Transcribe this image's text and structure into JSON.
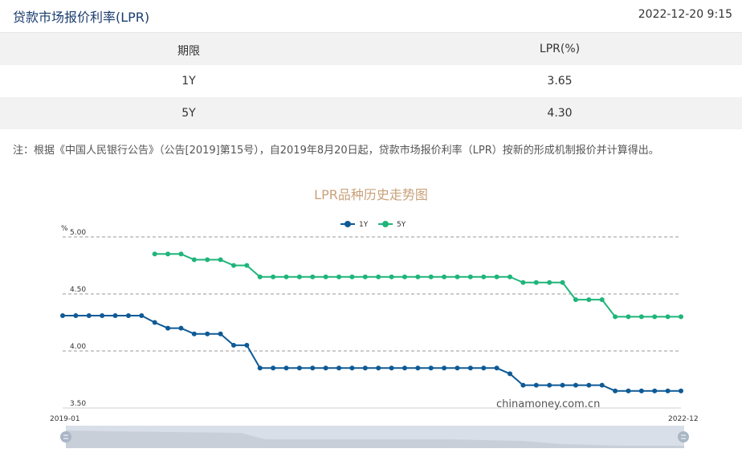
{
  "header": {
    "title": "贷款市场报价利率(LPR)",
    "timestamp": "2022-12-20 9:15"
  },
  "table": {
    "headers": [
      "期限",
      "LPR(%)"
    ],
    "rows": [
      {
        "term": "1Y",
        "rate": "3.65"
      },
      {
        "term": "5Y",
        "rate": "4.30"
      }
    ]
  },
  "note": "注：根据《中国人民银行公告》（公告[2019]第15号），自2019年8月20日起，贷款市场报价利率（LPR）按新的形成机制报价并计算得出。",
  "chart_data": {
    "type": "line",
    "title": "LPR品种历史走势图",
    "ylabel": "%",
    "ylim": [
      3.5,
      5.0
    ],
    "yticks": [
      "5.00",
      "4.50",
      "4.00",
      "3.50"
    ],
    "x_start_label": "2019-01",
    "x_end_label": "2022-12",
    "legend": "top-center",
    "grid": true,
    "watermark": "chinamoney.com.cn",
    "series": [
      {
        "name": "1Y",
        "color": "#0e5a96",
        "values": [
          4.31,
          4.31,
          4.31,
          4.31,
          4.31,
          4.31,
          4.31,
          4.25,
          4.2,
          4.2,
          4.15,
          4.15,
          4.15,
          4.05,
          4.05,
          3.85,
          3.85,
          3.85,
          3.85,
          3.85,
          3.85,
          3.85,
          3.85,
          3.85,
          3.85,
          3.85,
          3.85,
          3.85,
          3.85,
          3.85,
          3.85,
          3.85,
          3.85,
          3.85,
          3.8,
          3.7,
          3.7,
          3.7,
          3.7,
          3.7,
          3.7,
          3.7,
          3.65,
          3.65,
          3.65,
          3.65,
          3.65,
          3.65
        ]
      },
      {
        "name": "5Y",
        "color": "#1fb57a",
        "values": [
          null,
          null,
          null,
          null,
          null,
          null,
          null,
          4.85,
          4.85,
          4.85,
          4.8,
          4.8,
          4.8,
          4.75,
          4.75,
          4.65,
          4.65,
          4.65,
          4.65,
          4.65,
          4.65,
          4.65,
          4.65,
          4.65,
          4.65,
          4.65,
          4.65,
          4.65,
          4.65,
          4.65,
          4.65,
          4.65,
          4.65,
          4.65,
          4.65,
          4.6,
          4.6,
          4.6,
          4.6,
          4.45,
          4.45,
          4.45,
          4.3,
          4.3,
          4.3,
          4.3,
          4.3,
          4.3
        ]
      }
    ]
  }
}
